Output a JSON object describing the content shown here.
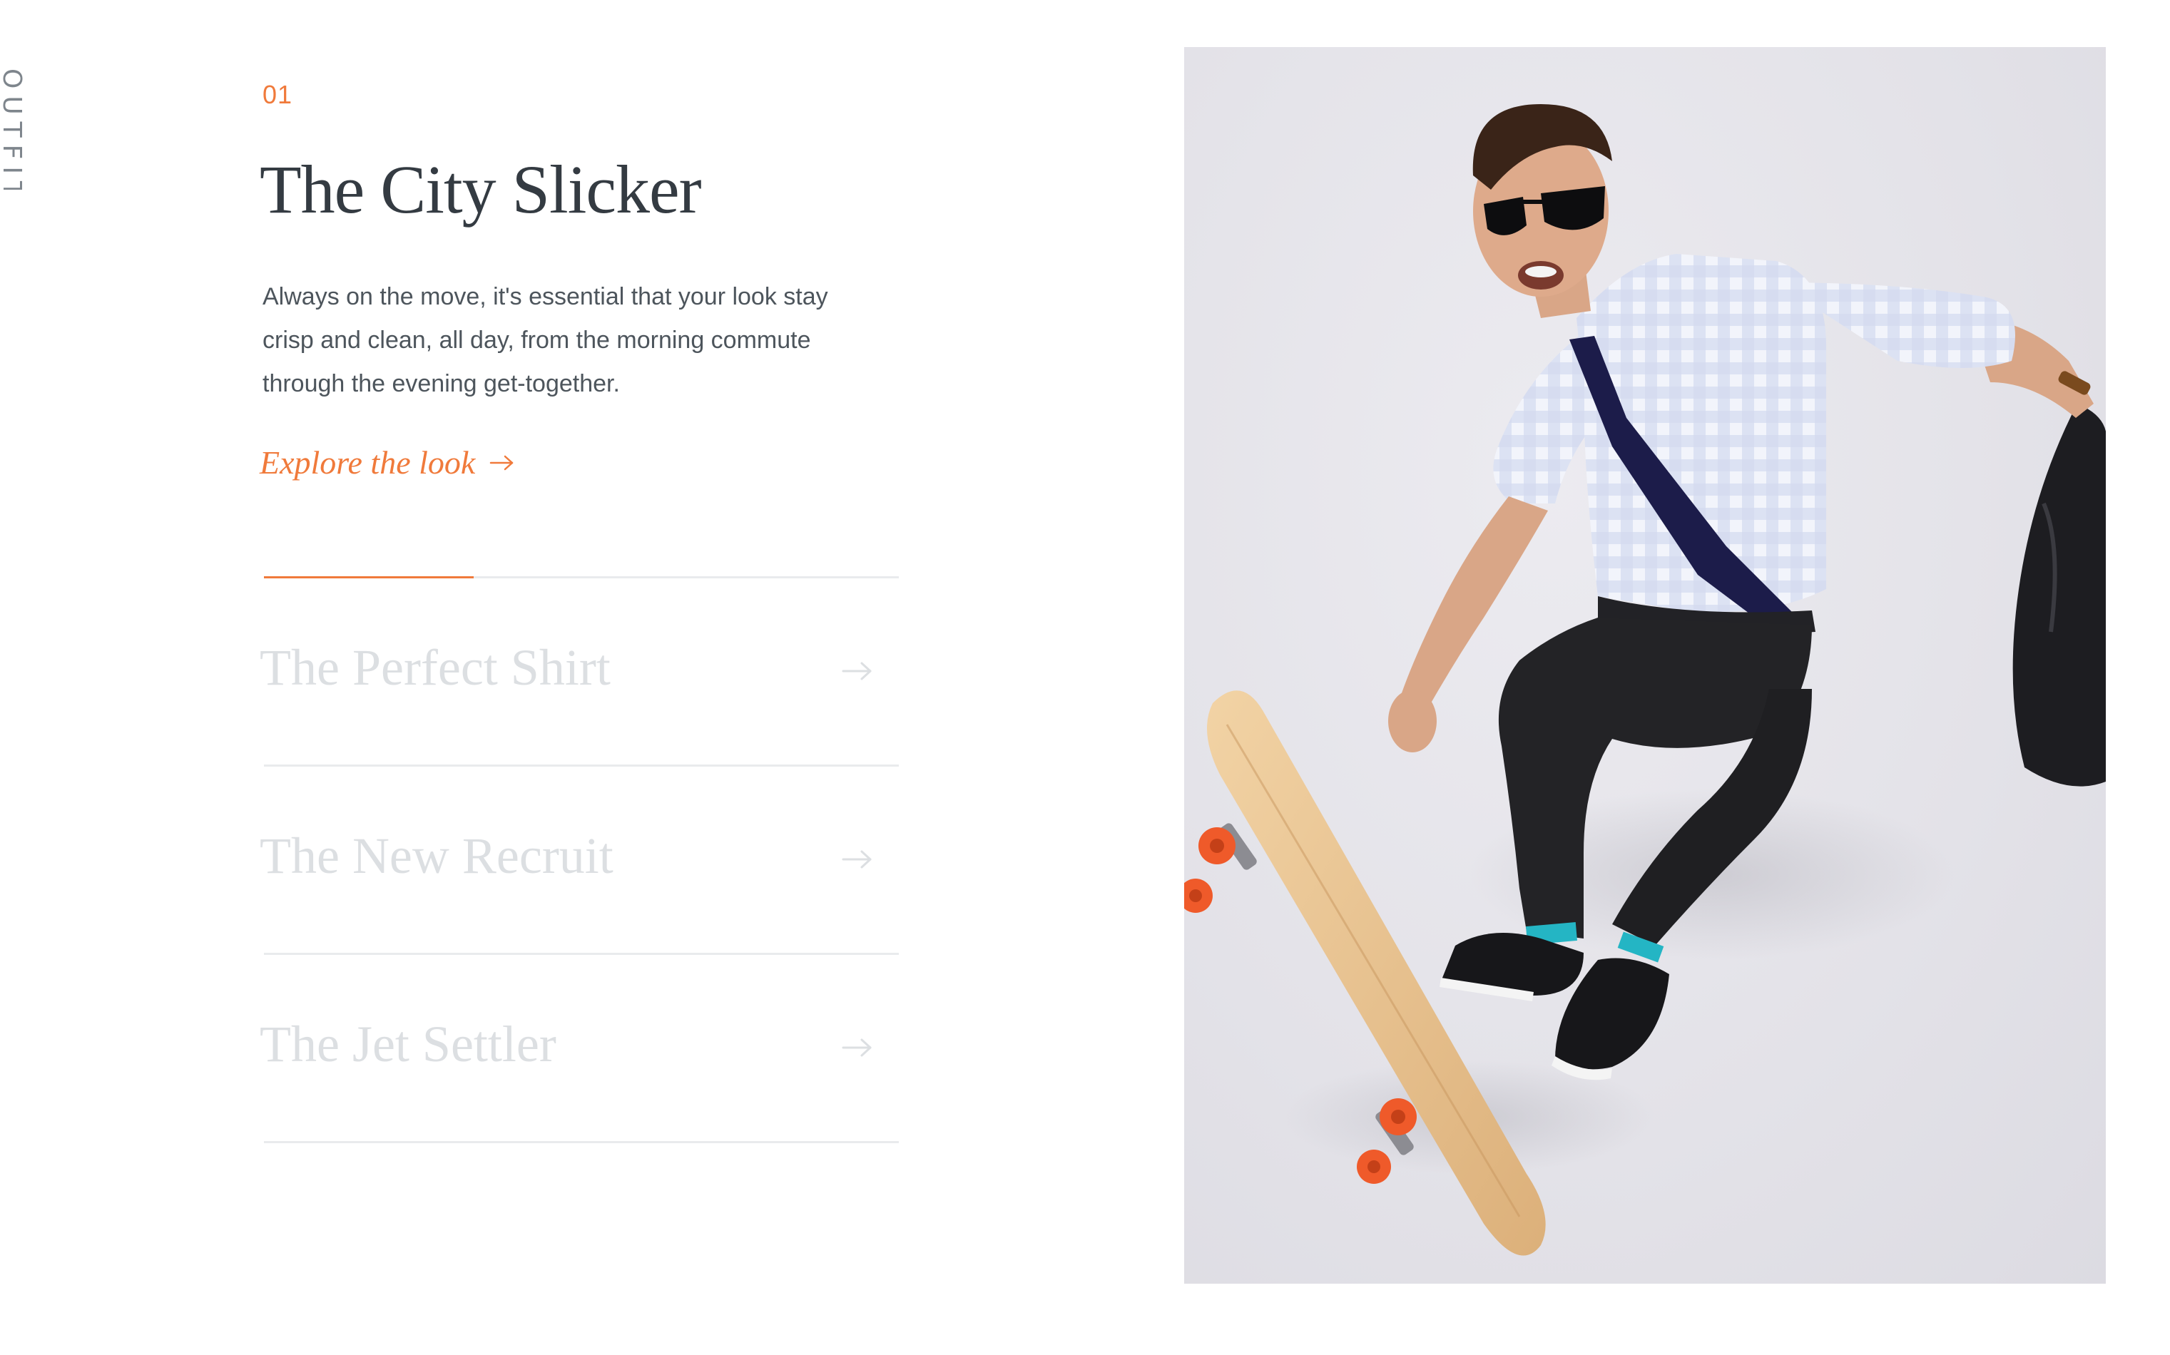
{
  "side_label": "OUTFITS",
  "feature": {
    "number": "01",
    "title": "The City Slicker",
    "description": "Always on the move, it's essential that your look stay crisp and clean, all day, from the morning commute through the evening get-together.",
    "cta_label": "Explore the look",
    "cta_icon": "arrow-right-icon"
  },
  "progress": {
    "fraction": 0.33
  },
  "looks": [
    {
      "title": "The Perfect Shirt",
      "icon": "arrow-right-icon"
    },
    {
      "title": "The New Recruit",
      "icon": "arrow-right-icon"
    },
    {
      "title": "The Jet Settler",
      "icon": "arrow-right-icon"
    }
  ],
  "colors": {
    "accent": "#f07a3b",
    "title": "#343b42",
    "body_text": "#4d555c",
    "muted_title": "#dcdfe2",
    "divider": "#e9ebed",
    "photo_background": "#e3e2e8"
  }
}
